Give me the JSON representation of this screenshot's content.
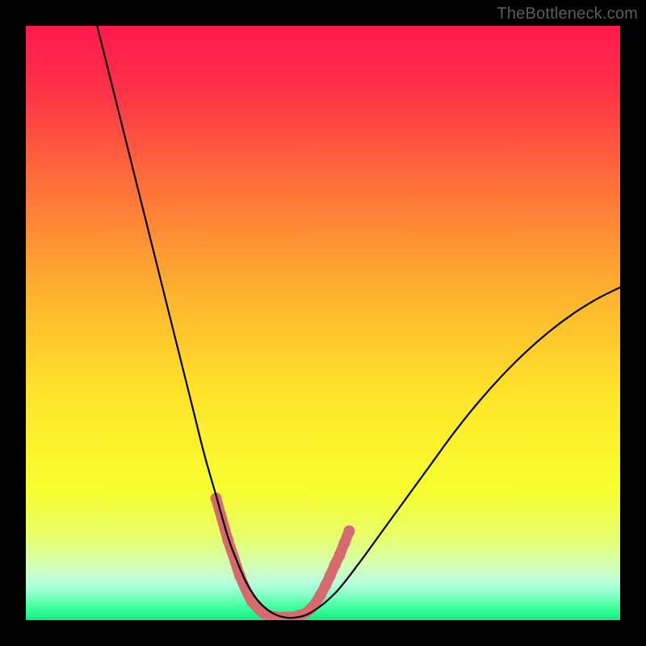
{
  "watermark": "TheBottleneck.com",
  "chart_data": {
    "type": "line",
    "title": "",
    "xlabel": "",
    "ylabel": "",
    "xlim": [
      0,
      100
    ],
    "ylim": [
      0,
      100
    ],
    "grid": false,
    "legend": false,
    "background_gradient_stops": [
      {
        "pos": 0.0,
        "color": "#ff1a4b"
      },
      {
        "pos": 0.1,
        "color": "#ff2f4a"
      },
      {
        "pos": 0.25,
        "color": "#ff6a3b"
      },
      {
        "pos": 0.45,
        "color": "#ffb22f"
      },
      {
        "pos": 0.62,
        "color": "#ffe42a"
      },
      {
        "pos": 0.78,
        "color": "#f7ff2e"
      },
      {
        "pos": 0.86,
        "color": "#e9ff6a"
      },
      {
        "pos": 0.91,
        "color": "#d2ffb7"
      },
      {
        "pos": 0.94,
        "color": "#b4ffe0"
      },
      {
        "pos": 0.965,
        "color": "#6cffb8"
      },
      {
        "pos": 0.985,
        "color": "#2cfd93"
      },
      {
        "pos": 1.0,
        "color": "#16e887"
      }
    ],
    "series": [
      {
        "name": "bottleneck-curve",
        "color": "#000000",
        "width": 2.2,
        "x": [
          12,
          14,
          16,
          18,
          20,
          22,
          24,
          26,
          28,
          30,
          32,
          34,
          35.5,
          37,
          38.5,
          40,
          41.5,
          43,
          45,
          48,
          52,
          56,
          60,
          64,
          68,
          72,
          76,
          80,
          84,
          88,
          92,
          96,
          100
        ],
        "y": [
          100,
          92,
          84,
          76,
          68,
          60,
          52,
          44,
          36,
          28,
          21,
          14,
          10,
          6.5,
          4,
          2.3,
          1.2,
          0.6,
          0.4,
          1.3,
          4.5,
          9.5,
          15,
          20.5,
          26,
          31.5,
          36.5,
          41,
          45,
          48.5,
          51.5,
          54,
          56
        ]
      }
    ],
    "markers": {
      "name": "highlight-segment",
      "color": "#d76a6f",
      "radius": 7,
      "stroke_width": 13,
      "points_xy": [
        [
          32.0,
          20.5
        ],
        [
          33.0,
          17.0
        ],
        [
          34.0,
          13.5
        ],
        [
          35.0,
          10.5
        ],
        [
          36.0,
          7.5
        ],
        [
          37.0,
          5.2
        ],
        [
          38.0,
          3.2
        ],
        [
          39.0,
          2.0
        ],
        [
          40.0,
          1.2
        ],
        [
          41.0,
          0.8
        ],
        [
          42.0,
          0.55
        ],
        [
          43.0,
          0.5
        ],
        [
          44.0,
          0.5
        ],
        [
          45.0,
          0.55
        ],
        [
          46.0,
          0.8
        ],
        [
          47.0,
          1.2
        ],
        [
          48.0,
          2.0
        ],
        [
          48.8,
          3.0
        ],
        [
          49.6,
          4.3
        ],
        [
          50.4,
          5.8
        ],
        [
          51.2,
          7.5
        ],
        [
          52.0,
          9.3
        ],
        [
          52.8,
          11.0
        ],
        [
          53.6,
          13.0
        ],
        [
          54.4,
          15.0
        ]
      ]
    }
  }
}
